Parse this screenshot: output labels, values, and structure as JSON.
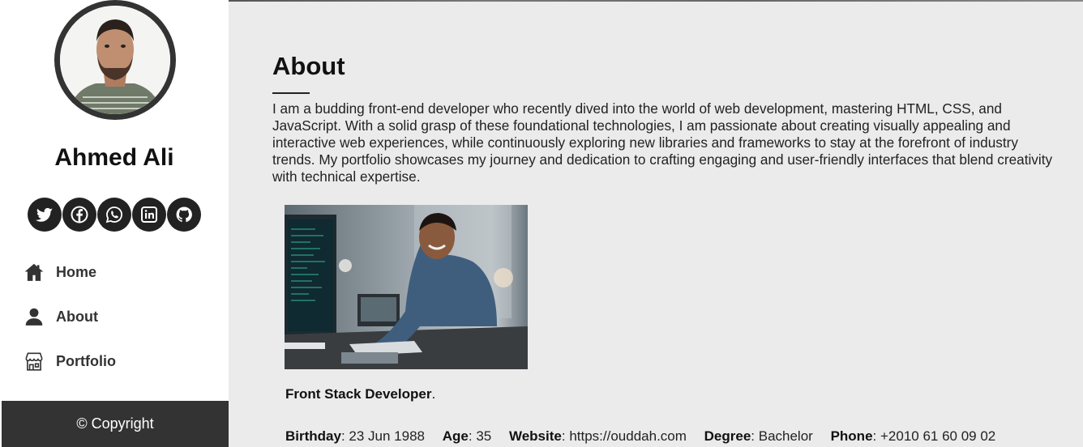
{
  "sidebar": {
    "name": "Ahmed Ali",
    "socials": [
      {
        "icon": "twitter-icon"
      },
      {
        "icon": "facebook-icon"
      },
      {
        "icon": "whatsapp-icon"
      },
      {
        "icon": "linkedin-icon"
      },
      {
        "icon": "github-icon"
      }
    ],
    "nav": [
      {
        "label": "Home",
        "icon": "home-icon"
      },
      {
        "label": "About",
        "icon": "user-icon"
      },
      {
        "label": "Portfolio",
        "icon": "store-icon"
      }
    ],
    "copyright": "© Copyright"
  },
  "main": {
    "title": "About",
    "description": "I am a budding front-end developer who recently dived into the world of web development, mastering HTML, CSS, and JavaScript. With a solid grasp of these foundational technologies, I am passionate about creating visually appealing and interactive web experiences, while continuously exploring new libraries and frameworks to stay at the forefront of industry trends. My portfolio showcases my journey and dedication to crafting engaging and user-friendly interfaces that blend creativity with technical expertise.",
    "role": "Front Stack Developer",
    "role_suffix": ".",
    "details": [
      {
        "label": "Birthday",
        "value": "23 Jun 1988"
      },
      {
        "label": "Age",
        "value": "35"
      },
      {
        "label": "Website",
        "value": "https://ouddah.com"
      },
      {
        "label": "Degree",
        "value": "Bachelor"
      },
      {
        "label": "Phone",
        "value": "+2010 61 60 09 02"
      }
    ]
  },
  "colors": {
    "sidebar_bg": "#ffffff",
    "main_bg": "#ebebeb",
    "dark": "#333333"
  }
}
